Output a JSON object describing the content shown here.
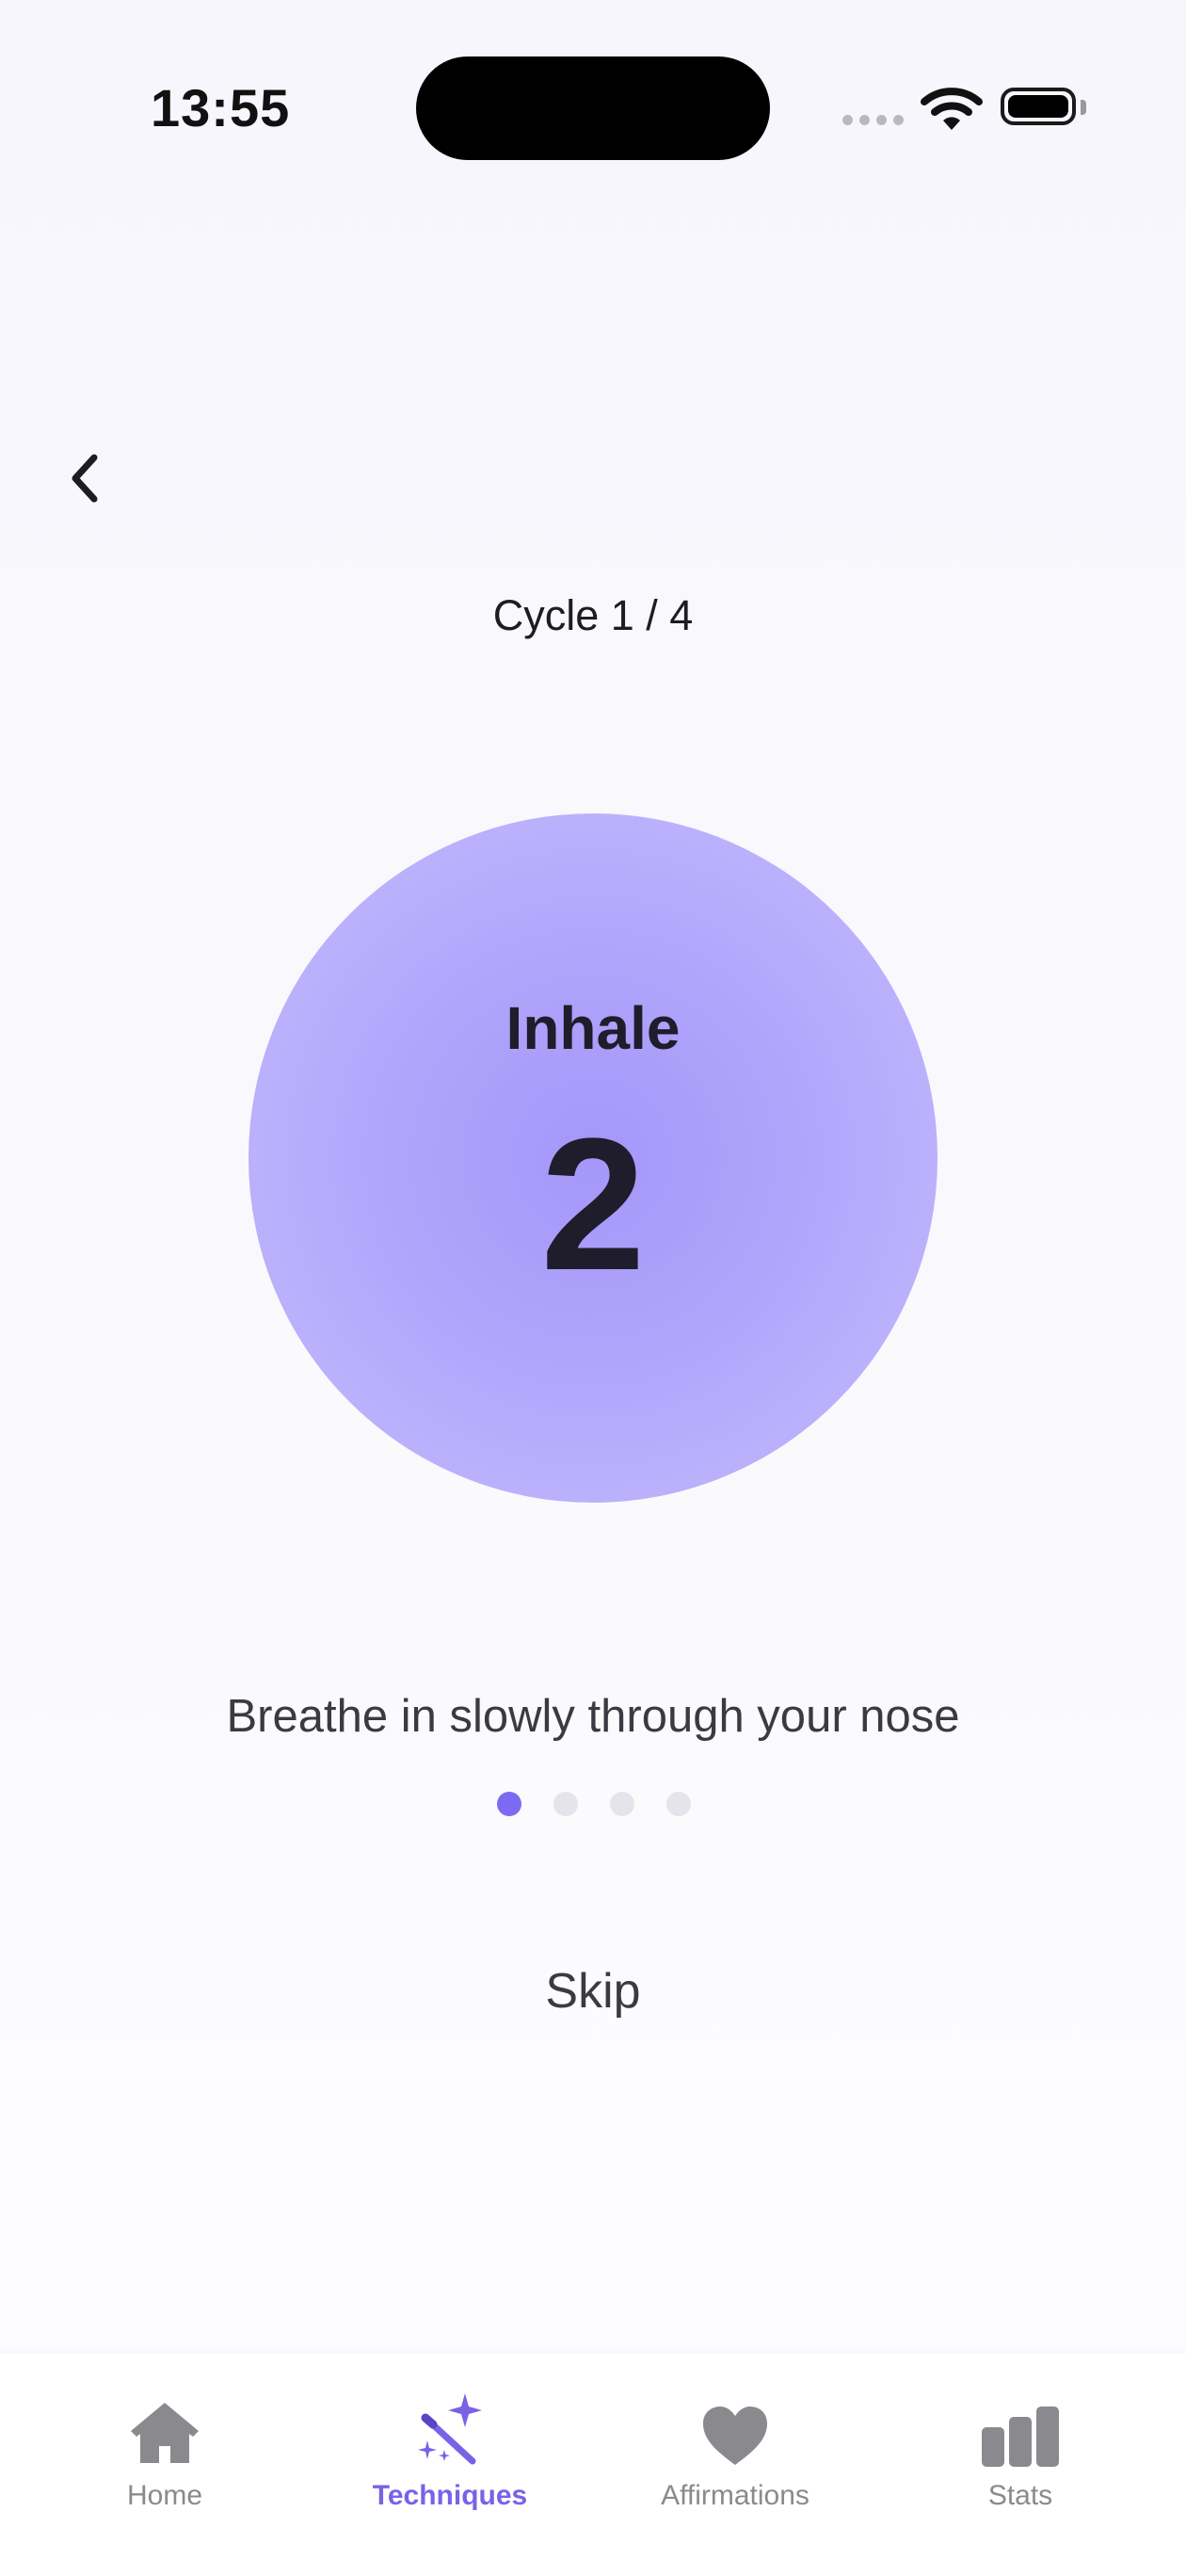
{
  "status_bar": {
    "time": "13:55"
  },
  "session": {
    "cycle_label": "Cycle 1 / 4",
    "phase": "Inhale",
    "count": "2",
    "instruction": "Breathe in slowly through your nose",
    "step_total": 4,
    "step_current": 1,
    "skip_label": "Skip"
  },
  "colors": {
    "accent": "#7B61E8",
    "dot_active": "#7C6AF2",
    "dot_inactive": "#E4E4EA",
    "circle": "#AFA3FB",
    "tab_inactive": "#8A8A8E"
  },
  "tabs": [
    {
      "label": "Home",
      "icon": "house-icon",
      "active": false
    },
    {
      "label": "Techniques",
      "icon": "magic-wand-icon",
      "active": true
    },
    {
      "label": "Affirmations",
      "icon": "heart-icon",
      "active": false
    },
    {
      "label": "Stats",
      "icon": "bar-chart-icon",
      "active": false
    }
  ]
}
